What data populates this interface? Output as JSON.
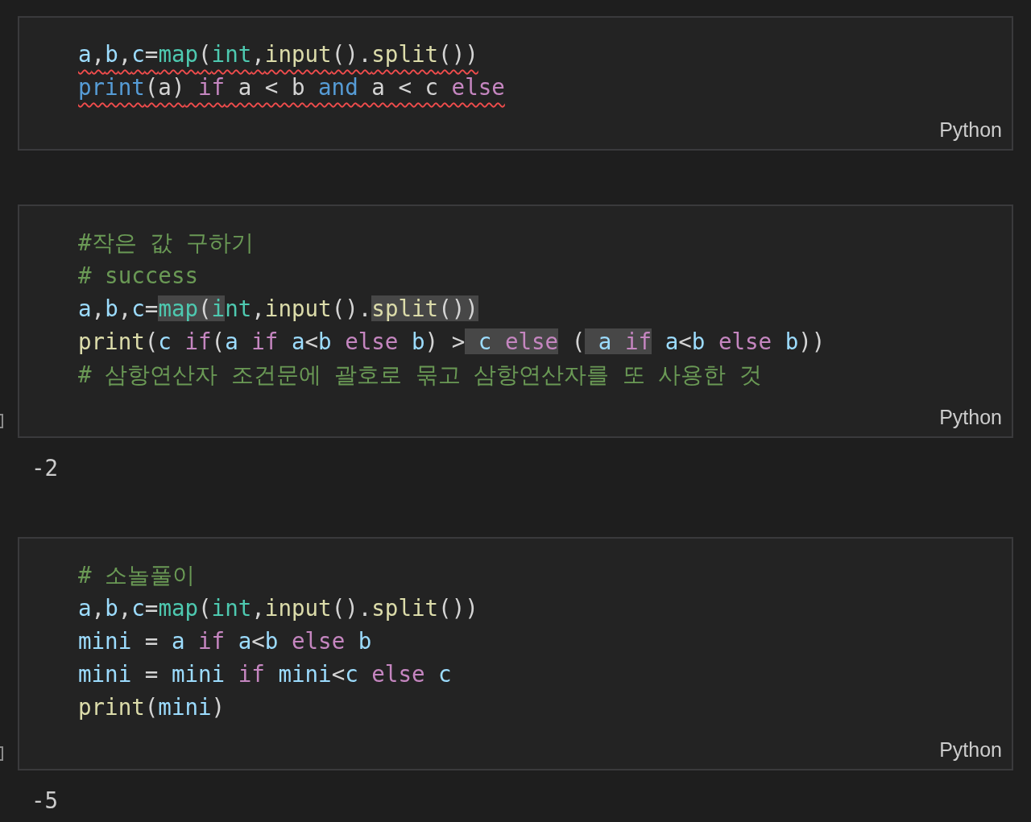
{
  "cells": [
    {
      "language": "Python",
      "marker": false,
      "lines": [
        {
          "error": true,
          "tokens": [
            {
              "t": "a",
              "kind": "var",
              "hl": false
            },
            {
              "t": ",",
              "kind": "plain",
              "hl": false
            },
            {
              "t": "b",
              "kind": "var",
              "hl": false
            },
            {
              "t": ",",
              "kind": "plain",
              "hl": false
            },
            {
              "t": "c",
              "kind": "var",
              "hl": false
            },
            {
              "t": "=",
              "kind": "plain",
              "hl": false
            },
            {
              "t": "map",
              "kind": "cls",
              "hl": false
            },
            {
              "t": "(",
              "kind": "plain",
              "hl": false
            },
            {
              "t": "int",
              "kind": "cls",
              "hl": false
            },
            {
              "t": ",",
              "kind": "plain",
              "hl": false
            },
            {
              "t": "input",
              "kind": "func",
              "hl": false
            },
            {
              "t": "().",
              "kind": "plain",
              "hl": false
            },
            {
              "t": "split",
              "kind": "func",
              "hl": false
            },
            {
              "t": "())",
              "kind": "plain",
              "hl": false
            }
          ]
        },
        {
          "error": true,
          "tokens": [
            {
              "t": "print",
              "kind": "blue",
              "hl": false
            },
            {
              "t": "(a)",
              "kind": "plain",
              "hl": false
            },
            {
              "t": " if",
              "kind": "kw",
              "hl": false
            },
            {
              "t": " a < b",
              "kind": "plain",
              "hl": false
            },
            {
              "t": " and",
              "kind": "blue",
              "hl": false
            },
            {
              "t": " a < c",
              "kind": "plain",
              "hl": false
            },
            {
              "t": " else",
              "kind": "kw",
              "hl": false
            }
          ]
        }
      ]
    },
    {
      "language": "Python",
      "marker": true,
      "output": "-2",
      "lines": [
        {
          "error": false,
          "tokens": [
            {
              "t": "#작은 값 구하기",
              "kind": "comment",
              "hl": false
            }
          ]
        },
        {
          "error": false,
          "tokens": [
            {
              "t": "# success",
              "kind": "comment",
              "hl": false
            }
          ]
        },
        {
          "error": false,
          "tokens": [
            {
              "t": "a",
              "kind": "var",
              "hl": false
            },
            {
              "t": ",",
              "kind": "plain",
              "hl": false
            },
            {
              "t": "b",
              "kind": "var",
              "hl": false
            },
            {
              "t": ",",
              "kind": "plain",
              "hl": false
            },
            {
              "t": "c",
              "kind": "var",
              "hl": false
            },
            {
              "t": "=",
              "kind": "plain",
              "hl": false
            },
            {
              "t": "map",
              "kind": "cls",
              "hl": true
            },
            {
              "t": "(",
              "kind": "plain",
              "hl": true
            },
            {
              "t": "i",
              "kind": "cls",
              "hl": true
            },
            {
              "t": "nt",
              "kind": "cls",
              "hl": false
            },
            {
              "t": ",",
              "kind": "plain",
              "hl": false
            },
            {
              "t": "input",
              "kind": "func",
              "hl": false
            },
            {
              "t": "().",
              "kind": "plain",
              "hl": false
            },
            {
              "t": "split",
              "kind": "func",
              "hl": true
            },
            {
              "t": "())",
              "kind": "plain",
              "hl": true
            }
          ]
        },
        {
          "error": false,
          "tokens": [
            {
              "t": "print",
              "kind": "func",
              "hl": false
            },
            {
              "t": "(",
              "kind": "plain",
              "hl": false
            },
            {
              "t": "c",
              "kind": "var",
              "hl": false
            },
            {
              "t": " if",
              "kind": "kw",
              "hl": false
            },
            {
              "t": "(",
              "kind": "plain",
              "hl": false
            },
            {
              "t": "a",
              "kind": "var",
              "hl": false
            },
            {
              "t": " if",
              "kind": "kw",
              "hl": false
            },
            {
              "t": " a",
              "kind": "var",
              "hl": false
            },
            {
              "t": "<",
              "kind": "plain",
              "hl": false
            },
            {
              "t": "b",
              "kind": "var",
              "hl": false
            },
            {
              "t": " else",
              "kind": "kw",
              "hl": false
            },
            {
              "t": " b",
              "kind": "var",
              "hl": false
            },
            {
              "t": ") >",
              "kind": "plain",
              "hl": false
            },
            {
              "t": " c",
              "kind": "var",
              "hl": true
            },
            {
              "t": " else",
              "kind": "kw",
              "hl": true
            },
            {
              "t": " (",
              "kind": "plain",
              "hl": false
            },
            {
              "t": " a",
              "kind": "var",
              "hl": true
            },
            {
              "t": " if",
              "kind": "kw",
              "hl": true
            },
            {
              "t": " a",
              "kind": "var",
              "hl": false
            },
            {
              "t": "<",
              "kind": "plain",
              "hl": false
            },
            {
              "t": "b",
              "kind": "var",
              "hl": false
            },
            {
              "t": " else",
              "kind": "kw",
              "hl": false
            },
            {
              "t": " b",
              "kind": "var",
              "hl": false
            },
            {
              "t": "))",
              "kind": "plain",
              "hl": false
            }
          ]
        },
        {
          "error": false,
          "tokens": [
            {
              "t": "# 삼항연산자 조건문에 괄호로 묶고 삼항연산자를 또 사용한 것",
              "kind": "comment",
              "hl": false
            }
          ]
        }
      ]
    },
    {
      "language": "Python",
      "marker": true,
      "output": "-5",
      "lines": [
        {
          "error": false,
          "tokens": [
            {
              "t": "# 소놀풀이",
              "kind": "comment",
              "hl": false
            }
          ]
        },
        {
          "error": false,
          "tokens": [
            {
              "t": "a",
              "kind": "var",
              "hl": false
            },
            {
              "t": ",",
              "kind": "plain",
              "hl": false
            },
            {
              "t": "b",
              "kind": "var",
              "hl": false
            },
            {
              "t": ",",
              "kind": "plain",
              "hl": false
            },
            {
              "t": "c",
              "kind": "var",
              "hl": false
            },
            {
              "t": "=",
              "kind": "plain",
              "hl": false
            },
            {
              "t": "map",
              "kind": "cls",
              "hl": false
            },
            {
              "t": "(",
              "kind": "plain",
              "hl": false
            },
            {
              "t": "int",
              "kind": "cls",
              "hl": false
            },
            {
              "t": ",",
              "kind": "plain",
              "hl": false
            },
            {
              "t": "input",
              "kind": "func",
              "hl": false
            },
            {
              "t": "().",
              "kind": "plain",
              "hl": false
            },
            {
              "t": "split",
              "kind": "func",
              "hl": false
            },
            {
              "t": "())",
              "kind": "plain",
              "hl": false
            }
          ]
        },
        {
          "error": false,
          "tokens": [
            {
              "t": "mini",
              "kind": "var",
              "hl": false
            },
            {
              "t": " =",
              "kind": "plain",
              "hl": false
            },
            {
              "t": " a",
              "kind": "var",
              "hl": false
            },
            {
              "t": " if",
              "kind": "kw",
              "hl": false
            },
            {
              "t": " a",
              "kind": "var",
              "hl": false
            },
            {
              "t": "<",
              "kind": "plain",
              "hl": false
            },
            {
              "t": "b",
              "kind": "var",
              "hl": false
            },
            {
              "t": " else",
              "kind": "kw",
              "hl": false
            },
            {
              "t": " b",
              "kind": "var",
              "hl": false
            }
          ]
        },
        {
          "error": false,
          "tokens": [
            {
              "t": "mini",
              "kind": "var",
              "hl": false
            },
            {
              "t": " =",
              "kind": "plain",
              "hl": false
            },
            {
              "t": " mini",
              "kind": "var",
              "hl": false
            },
            {
              "t": " if",
              "kind": "kw",
              "hl": false
            },
            {
              "t": " mini",
              "kind": "var",
              "hl": false
            },
            {
              "t": "<",
              "kind": "plain",
              "hl": false
            },
            {
              "t": "c",
              "kind": "var",
              "hl": false
            },
            {
              "t": " else",
              "kind": "kw",
              "hl": false
            },
            {
              "t": " c",
              "kind": "var",
              "hl": false
            }
          ]
        },
        {
          "error": false,
          "tokens": [
            {
              "t": "print",
              "kind": "func",
              "hl": false
            },
            {
              "t": "(",
              "kind": "plain",
              "hl": false
            },
            {
              "t": "mini",
              "kind": "var",
              "hl": false
            },
            {
              "t": ")",
              "kind": "plain",
              "hl": false
            }
          ]
        }
      ]
    }
  ]
}
